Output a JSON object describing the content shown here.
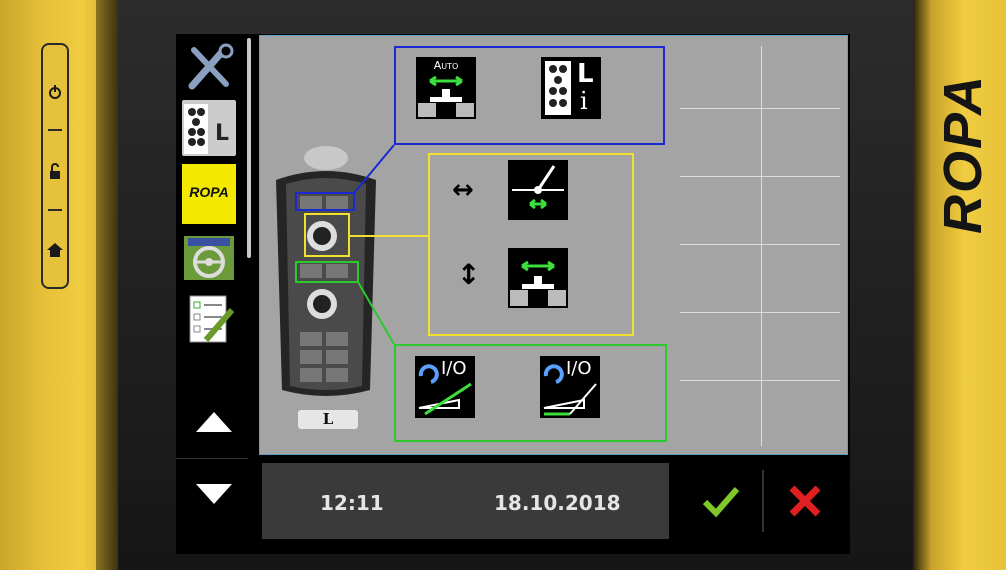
{
  "device": {
    "brand": "ROPA",
    "side_buttons": [
      {
        "name": "power",
        "icon": "power-icon"
      },
      {
        "name": "unlock",
        "icon": "unlock-icon"
      },
      {
        "name": "home",
        "icon": "home-icon"
      }
    ]
  },
  "sidebar": {
    "items": [
      {
        "name": "tools",
        "icon": "wrench-screwdriver-icon"
      },
      {
        "name": "keypad-left",
        "icon": "keypad-l-icon",
        "label": "L"
      },
      {
        "name": "ropa-logo",
        "label": "ROPA"
      },
      {
        "name": "steering",
        "icon": "steering-wheel-icon"
      },
      {
        "name": "checklist",
        "icon": "checklist-pencil-icon"
      }
    ],
    "up_label": "▲",
    "down_label": "▼"
  },
  "main": {
    "remote_label": "L",
    "blue_group": {
      "auto_label": "Auto",
      "keypad_label": "L",
      "keypad_sub": "i"
    },
    "yellow_group": {
      "rows": [
        {
          "symbol": "↔",
          "icon": "angle-horizontal-icon"
        },
        {
          "symbol": "↕",
          "icon": "ground-horizontal-icon"
        }
      ]
    },
    "green_group": {
      "items": [
        {
          "label": "I/O",
          "icon": "rotate-io-icon"
        },
        {
          "label": "I/O",
          "icon": "rotate-io-icon"
        }
      ]
    }
  },
  "footer": {
    "time": "12:11",
    "date": "18.10.2018"
  },
  "colors": {
    "bezel": "#f0cc40",
    "panel": "#a4a4a4",
    "blue_box": "#1a2ad0",
    "yellow_box": "#f0e030",
    "green_box": "#2cc82c",
    "ok": "#7ec82a",
    "cancel": "#e02020"
  }
}
